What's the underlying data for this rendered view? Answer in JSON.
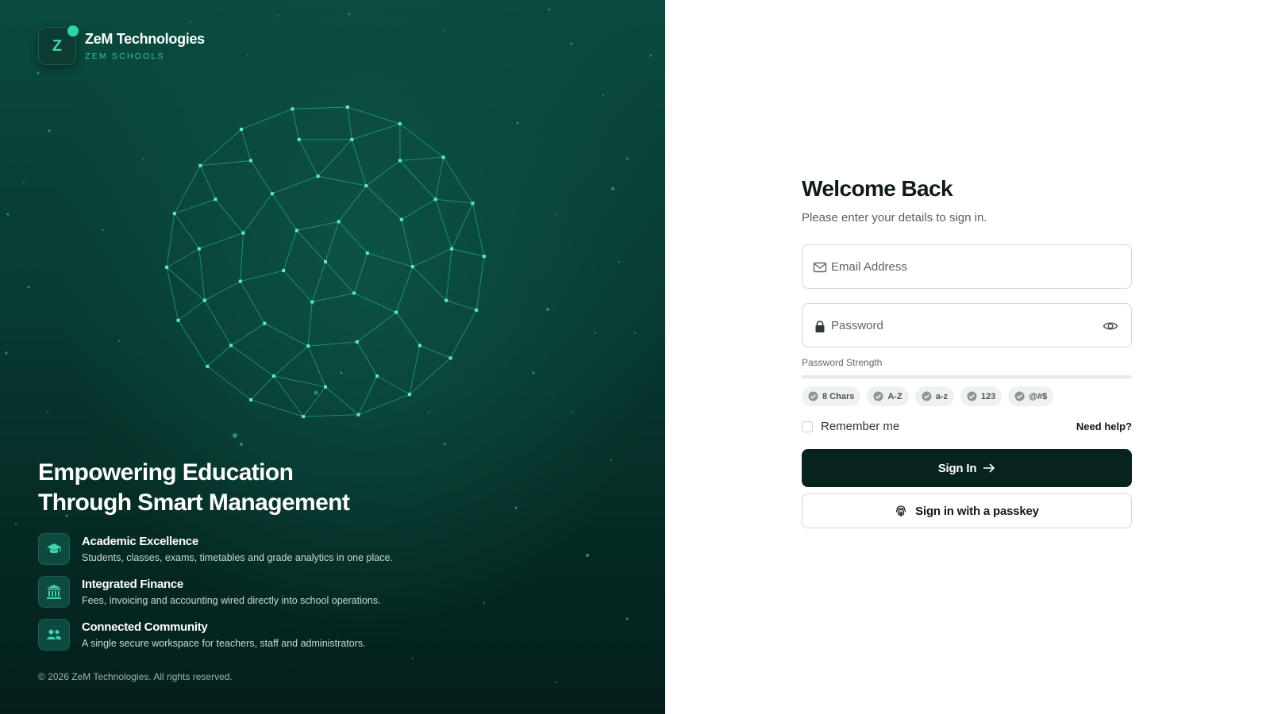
{
  "brand": {
    "logo_letter": "Z",
    "name": "ZeM Technologies",
    "subtitle": "ZEM SCHOOLS"
  },
  "hero": {
    "headline_line1": "Empowering Education",
    "headline_line2": "Through Smart Management"
  },
  "features": [
    {
      "icon": "graduation-cap-icon",
      "title": "Academic Excellence",
      "description": "Students, classes, exams, timetables and grade analytics in one place."
    },
    {
      "icon": "bank-icon",
      "title": "Integrated Finance",
      "description": "Fees, invoicing and accounting wired directly into school operations."
    },
    {
      "icon": "users-icon",
      "title": "Connected Community",
      "description": "A single secure workspace for teachers, staff and administrators."
    }
  ],
  "copyright": "© 2026 ZeM Technologies. All rights reserved.",
  "login": {
    "title": "Welcome Back",
    "subtitle": "Please enter your details to sign in.",
    "email_placeholder": "Email Address",
    "email_value": "",
    "password_placeholder": "Password",
    "password_value": "",
    "strength_label": "Password Strength",
    "strength_fraction": 0,
    "requirements": [
      "8 Chars",
      "A-Z",
      "a-z",
      "123",
      "@#$"
    ],
    "remember_label": "Remember me",
    "remember_checked": false,
    "help_link": "Need help?",
    "sign_in_label": "Sign In",
    "passkey_label": "Sign in with a passkey"
  },
  "colors": {
    "accent": "#2dd4aa",
    "panel_dark": "#073a31",
    "button_dark": "#07231e"
  }
}
